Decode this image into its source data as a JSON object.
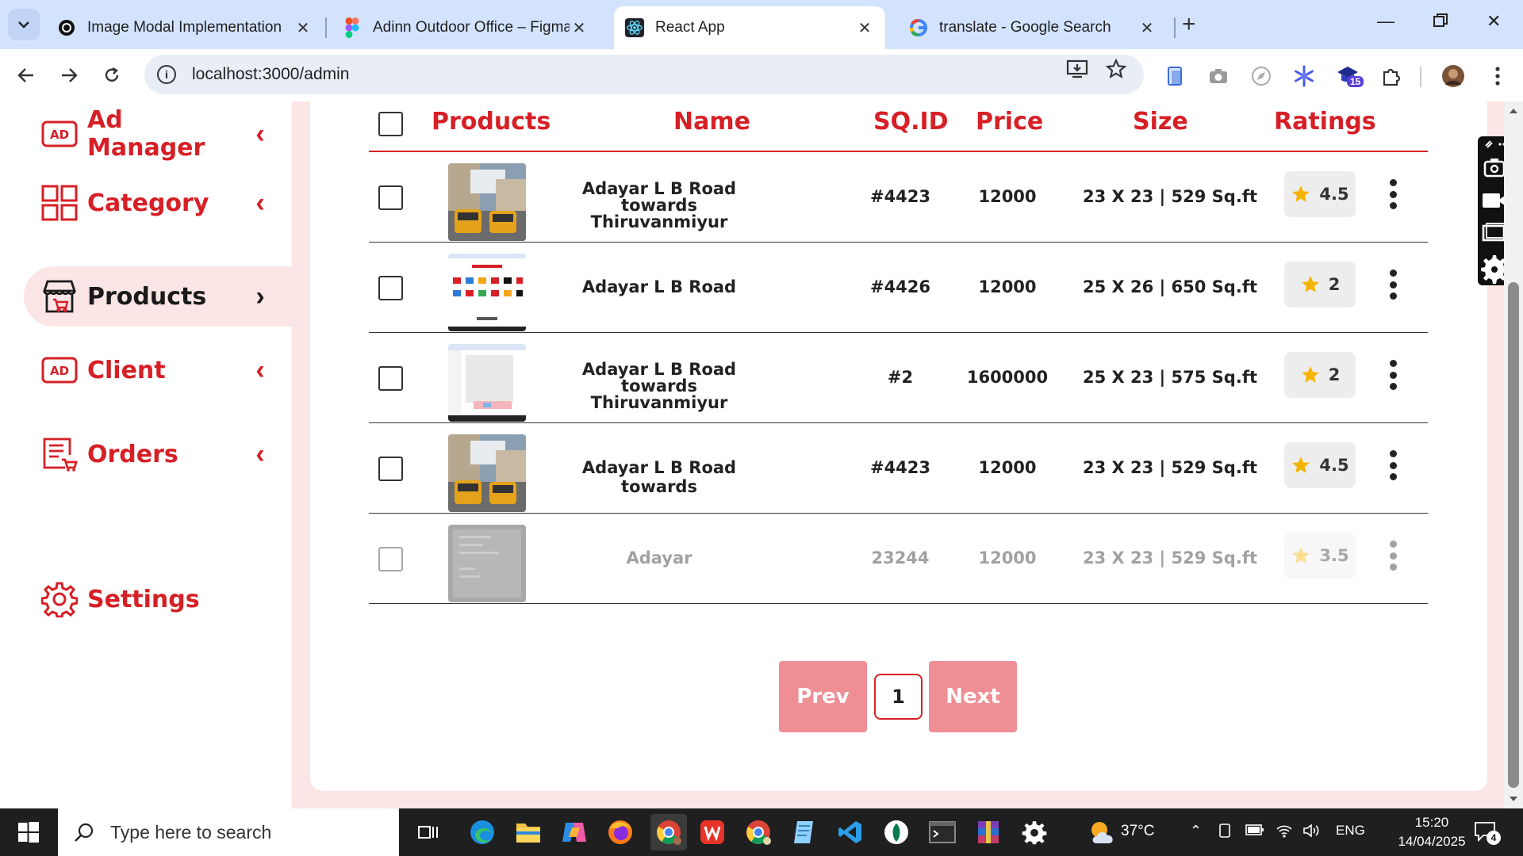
{
  "browser": {
    "tabs": [
      {
        "title": "Image Modal Implementation",
        "icon": "openai-icon"
      },
      {
        "title": "Adinn Outdoor Office – Figma",
        "icon": "figma-icon"
      },
      {
        "title": "React App",
        "icon": "react-icon",
        "active": true
      },
      {
        "title": "translate - Google Search",
        "icon": "google-icon"
      }
    ],
    "url": "localhost:3000/admin",
    "extension_badge": "15"
  },
  "sidebar": {
    "items": [
      {
        "label": "Ad Manager",
        "icon": "ad-icon"
      },
      {
        "label": "Category",
        "icon": "grid-icon"
      },
      {
        "label": "Products",
        "icon": "store-icon",
        "active": true
      },
      {
        "label": "Client",
        "icon": "ad-icon"
      },
      {
        "label": "Orders",
        "icon": "orders-icon"
      },
      {
        "label": "Settings",
        "icon": "gear-icon"
      }
    ]
  },
  "table": {
    "headers": {
      "products": "Products",
      "name": "Name",
      "sqid": "SQ.ID",
      "price": "Price",
      "size": "Size",
      "ratings": "Ratings"
    },
    "rows": [
      {
        "name_line1": "Adayar L B Road towards",
        "name_line2": "Thiruvanmiyur",
        "sqid": "#4423",
        "price": "12000",
        "size": "23 X 23 | 529 Sq.ft",
        "rating": "4.5"
      },
      {
        "name_line1": "Adayar L B Road",
        "name_line2": "",
        "sqid": "#4426",
        "price": "12000",
        "size": "25 X 26 | 650 Sq.ft",
        "rating": "2"
      },
      {
        "name_line1": "Adayar L B Road towards",
        "name_line2": "Thiruvanmiyur",
        "sqid": "#2",
        "price": "1600000",
        "size": "25 X 23 | 575 Sq.ft",
        "rating": "2"
      },
      {
        "name_line1": "Adayar L B Road towards",
        "name_line2": "",
        "sqid": "#4423",
        "price": "12000",
        "size": "23 X 23 | 529 Sq.ft",
        "rating": "4.5"
      },
      {
        "name_line1": "Adayar",
        "name_line2": "",
        "sqid": "23244",
        "price": "12000",
        "size": "23 X 23 | 529 Sq.ft",
        "rating": "3.5",
        "disabled": true
      }
    ]
  },
  "pagination": {
    "prev": "Prev",
    "page": "1",
    "next": "Next"
  },
  "taskbar": {
    "search_placeholder": "Type here to search",
    "weather": "37°C",
    "language": "ENG",
    "time": "15:20",
    "date": "14/04/2025",
    "notifications": "4"
  },
  "colors": {
    "brand_red": "#d71f26",
    "pink_bg": "#fbe5e5",
    "button_pink": "#ef8f95",
    "star": "#f5b400"
  }
}
